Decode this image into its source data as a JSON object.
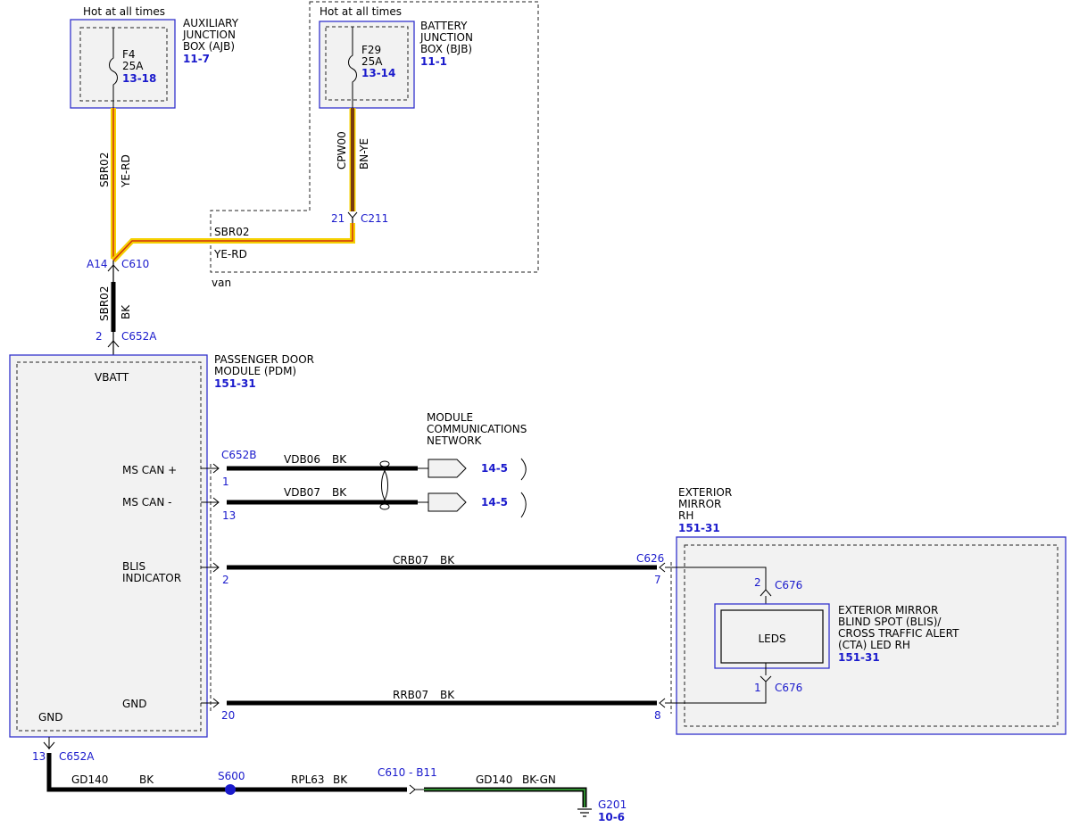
{
  "colors": {
    "box_border": "#3333cc",
    "ref_link": "#1a1acc",
    "wire_ye": "#f5d000",
    "wire_rd": "#d03010",
    "wire_bn": "#7a3b10",
    "wire_gn": "#2e8b2e",
    "wire_bk": "#000000"
  },
  "ajb": {
    "hot": "Hot at all times",
    "name_l1": "AUXILIARY",
    "name_l2": "JUNCTION",
    "name_l3": "BOX (AJB)",
    "ref": "11-7",
    "fuse": "F4",
    "amps": "25A",
    "fuse_ref": "13-18"
  },
  "bjb": {
    "hot": "Hot at all times",
    "name_l1": "BATTERY",
    "name_l2": "JUNCTION",
    "name_l3": "BOX (BJB)",
    "ref": "11-1",
    "fuse": "F29",
    "amps": "25A",
    "fuse_ref": "13-14"
  },
  "wires": {
    "sbr02_circuit": "SBR02",
    "sbr02_color": "YE-RD",
    "cpw00_circuit": "CPW00",
    "cpw00_color": "BN-YE",
    "c211_pin": "21",
    "c211": "C211",
    "van_circuit": "SBR02",
    "van_color": "YE-RD",
    "van_label": "van",
    "a14_pin": "A14",
    "c610": "C610",
    "sbr02_bk_circuit": "SBR02",
    "sbr02_bk_color": "BK",
    "c652a_pin": "2",
    "c652a": "C652A"
  },
  "pdm": {
    "name_l1": "PASSENGER DOOR",
    "name_l2": "MODULE (PDM)",
    "ref": "151-31",
    "vbatt": "VBATT",
    "ms_can_plus": "MS CAN +",
    "ms_can_minus": "MS CAN -",
    "blis_l1": "BLIS",
    "blis_l2": "INDICATOR",
    "gnd_inner": "GND",
    "gnd": "GND"
  },
  "network": {
    "l1": "MODULE",
    "l2": "COMMUNICATIONS",
    "l3": "NETWORK",
    "ref1": "14-5",
    "ref2": "14-5"
  },
  "signals": {
    "c652b": "C652B",
    "pin1": "1",
    "vdb06": "VDB06",
    "vdb06_color": "BK",
    "pin13": "13",
    "vdb07": "VDB07",
    "vdb07_color": "BK",
    "pin2": "2",
    "crb07": "CRB07",
    "crb07_color": "BK",
    "pin20": "20",
    "rrb07": "RRB07",
    "rrb07_color": "BK",
    "c626": "C626",
    "c626_pin7": "7",
    "c626_pin8": "8"
  },
  "mirror": {
    "name_l1": "EXTERIOR",
    "name_l2": "MIRROR",
    "name_l3": "RH",
    "ref": "151-31",
    "leds": "LEDS",
    "c676_top_pin": "2",
    "c676_top": "C676",
    "c676_bot_pin": "1",
    "c676_bot": "C676",
    "led_l1": "EXTERIOR MIRROR",
    "led_l2": "BLIND SPOT (BLIS)/",
    "led_l3": "CROSS TRAFFIC ALERT",
    "led_l4": "(CTA) LED RH",
    "led_ref": "151-31"
  },
  "ground": {
    "pin13": "13",
    "c652a": "C652A",
    "gd140": "GD140",
    "gd140_color": "BK",
    "s600": "S600",
    "rpl63": "RPL63",
    "rpl63_color": "BK",
    "c610_b11": "C610 - B11",
    "gd140_gn": "GD140",
    "gd140_gn_color": "BK-GN",
    "g201": "G201",
    "g201_ref": "10-6"
  }
}
